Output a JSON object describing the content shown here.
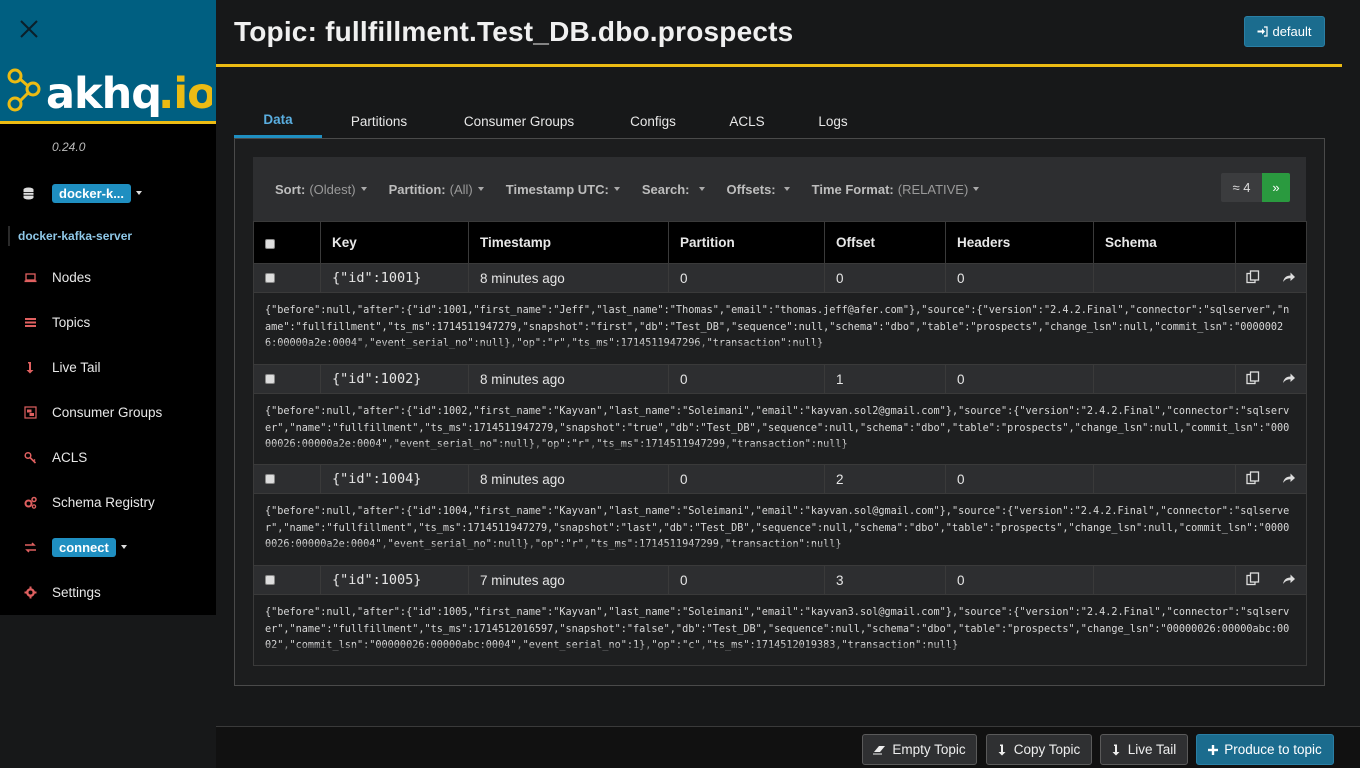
{
  "app": {
    "version": "0.24.0",
    "cluster_dropdown": "docker-k...",
    "cluster_name": "docker-kafka-server"
  },
  "nav": {
    "items": [
      {
        "label": "Nodes",
        "icon": "laptop-icon"
      },
      {
        "label": "Topics",
        "icon": "list-icon"
      },
      {
        "label": "Live Tail",
        "icon": "level-down-icon"
      },
      {
        "label": "Consumer Groups",
        "icon": "object-group-icon"
      },
      {
        "label": "ACLS",
        "icon": "key-icon"
      },
      {
        "label": "Schema Registry",
        "icon": "cogs-icon"
      },
      {
        "label": "Settings",
        "icon": "gear-icon"
      }
    ],
    "connect_label": "connect"
  },
  "header": {
    "title": "Topic: fullfillment.Test_DB.dbo.prospects",
    "default_btn": "default"
  },
  "tabs": [
    "Data",
    "Partitions",
    "Consumer Groups",
    "Configs",
    "ACLS",
    "Logs"
  ],
  "toolbar": {
    "sort_label": "Sort:",
    "sort_value": "(Oldest)",
    "partition_label": "Partition:",
    "partition_value": "(All)",
    "timestamp_label": "Timestamp UTC:",
    "search_label": "Search:",
    "offsets_label": "Offsets:",
    "timeformat_label": "Time Format:",
    "timeformat_value": "(RELATIVE)",
    "count": "≈ 4",
    "next": "»"
  },
  "table": {
    "headers": [
      "Key",
      "Timestamp",
      "Partition",
      "Offset",
      "Headers",
      "Schema"
    ],
    "rows": [
      {
        "key": "{\"id\":1001}",
        "timestamp": "8 minutes ago",
        "partition": "0",
        "offset": "0",
        "headers": "0",
        "schema": "",
        "value": "{\"before\":null,\"after\":{\"id\":1001,\"first_name\":\"Jeff\",\"last_name\":\"Thomas\",\"email\":\"thomas.jeff@afer.com\"},\"source\":{\"version\":\"2.4.2.Final\",\"connector\":\"sqlserver\",\"name\":\"fullfillment\",\"ts_ms\":1714511947279,\"snapshot\":\"first\",\"db\":\"Test_DB\",\"sequence\":null,\"schema\":\"dbo\",\"table\":\"prospects\",\"change_lsn\":null,\"commit_lsn\":\"00000026:00000a2e:0004\",\"event_serial_no\":null},\"op\":\"r\",\"ts_ms\":1714511947296,\"transaction\":null}"
      },
      {
        "key": "{\"id\":1002}",
        "timestamp": "8 minutes ago",
        "partition": "0",
        "offset": "1",
        "headers": "0",
        "schema": "",
        "value": "{\"before\":null,\"after\":{\"id\":1002,\"first_name\":\"Kayvan\",\"last_name\":\"Soleimani\",\"email\":\"kayvan.sol2@gmail.com\"},\"source\":{\"version\":\"2.4.2.Final\",\"connector\":\"sqlserver\",\"name\":\"fullfillment\",\"ts_ms\":1714511947279,\"snapshot\":\"true\",\"db\":\"Test_DB\",\"sequence\":null,\"schema\":\"dbo\",\"table\":\"prospects\",\"change_lsn\":null,\"commit_lsn\":\"00000026:00000a2e:0004\",\"event_serial_no\":null},\"op\":\"r\",\"ts_ms\":1714511947299,\"transaction\":null}"
      },
      {
        "key": "{\"id\":1004}",
        "timestamp": "8 minutes ago",
        "partition": "0",
        "offset": "2",
        "headers": "0",
        "schema": "",
        "value": "{\"before\":null,\"after\":{\"id\":1004,\"first_name\":\"Kayvan\",\"last_name\":\"Soleimani\",\"email\":\"kayvan.sol@gmail.com\"},\"source\":{\"version\":\"2.4.2.Final\",\"connector\":\"sqlserver\",\"name\":\"fullfillment\",\"ts_ms\":1714511947279,\"snapshot\":\"last\",\"db\":\"Test_DB\",\"sequence\":null,\"schema\":\"dbo\",\"table\":\"prospects\",\"change_lsn\":null,\"commit_lsn\":\"00000026:00000a2e:0004\",\"event_serial_no\":null},\"op\":\"r\",\"ts_ms\":1714511947299,\"transaction\":null}"
      },
      {
        "key": "{\"id\":1005}",
        "timestamp": "7 minutes ago",
        "partition": "0",
        "offset": "3",
        "headers": "0",
        "schema": "",
        "value": "{\"before\":null,\"after\":{\"id\":1005,\"first_name\":\"Kayvan\",\"last_name\":\"Soleimani\",\"email\":\"kayvan3.sol@gmail.com\"},\"source\":{\"version\":\"2.4.2.Final\",\"connector\":\"sqlserver\",\"name\":\"fullfillment\",\"ts_ms\":1714512016597,\"snapshot\":\"false\",\"db\":\"Test_DB\",\"sequence\":null,\"schema\":\"dbo\",\"table\":\"prospects\",\"change_lsn\":\"00000026:00000abc:0002\",\"commit_lsn\":\"00000026:00000abc:0004\",\"event_serial_no\":1},\"op\":\"c\",\"ts_ms\":1714512019383,\"transaction\":null}"
      }
    ]
  },
  "bottom": {
    "empty_topic": "Empty Topic",
    "copy_topic": "Copy Topic",
    "live_tail": "Live Tail",
    "produce": "Produce to topic"
  },
  "colors": {
    "brand_bg": "#005f81",
    "accent_gold": "#ecbb13",
    "primary_blue": "#1f8fc1",
    "success_green": "#2a9a3f",
    "key_red": "#e04a4a"
  }
}
